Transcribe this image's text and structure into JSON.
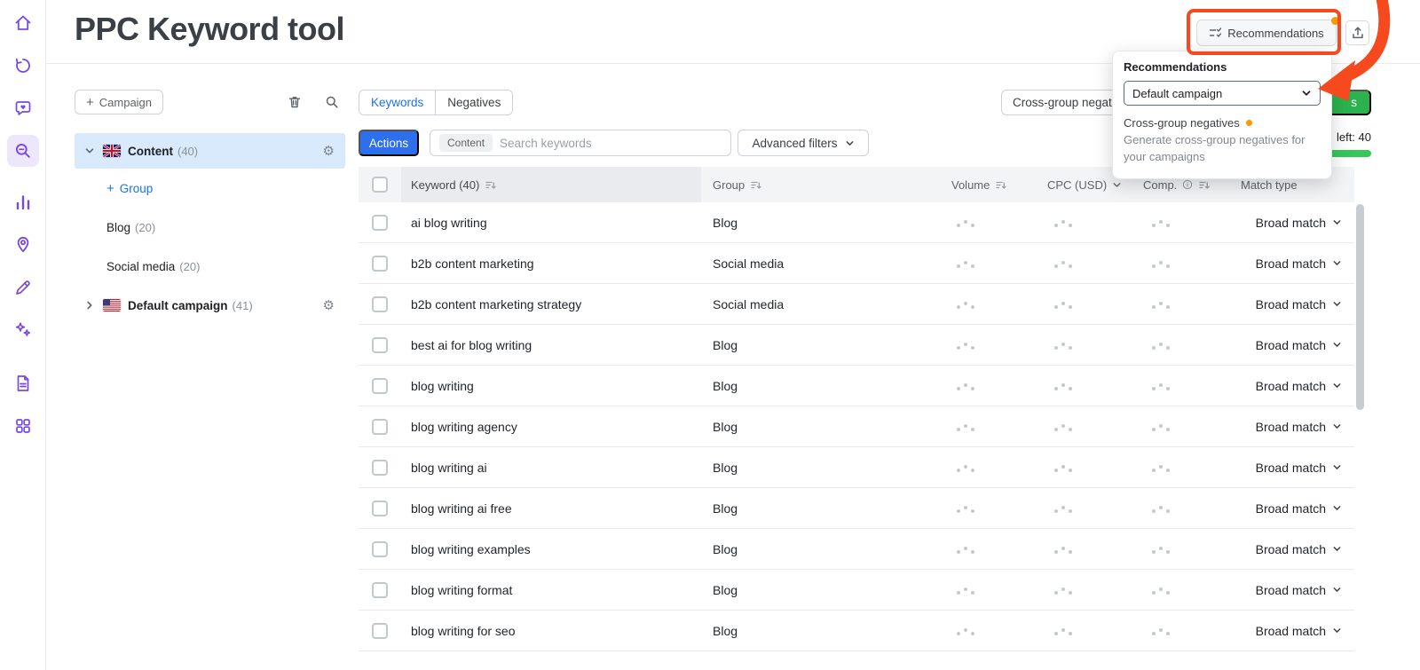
{
  "app_title": "PPC Keyword tool",
  "colors": {
    "accent_purple": "#7747e8",
    "accent_blue": "#2e6fed",
    "link_blue": "#1a73e8",
    "annotation_orange": "#f6491d",
    "notification_dot": "#ff9800",
    "green_button": "#2cb34d",
    "progress_green": "#35c759",
    "selected_tree_bg": "#d9eafd"
  },
  "sidebar": {
    "icons": [
      "home-icon",
      "sync-icon",
      "heart-chat-icon",
      "keyword-research-icon",
      "analytics-icon",
      "location-icon",
      "edit-icon",
      "ai-sparkles-icon",
      "reports-icon",
      "apps-icon"
    ],
    "active_icon": "keyword-research-icon"
  },
  "header": {
    "recommendations_button": "Recommendations"
  },
  "popover": {
    "title": "Recommendations",
    "campaign_select_value": "Default campaign",
    "item_title": "Cross-group negatives",
    "item_description": "Generate cross-group negatives for your campaigns"
  },
  "campaigns_panel": {
    "add_campaign_label": "Campaign",
    "tree": {
      "content_label": "Content",
      "content_count": "(40)",
      "add_group_label": "Group",
      "groups": [
        {
          "label": "Blog",
          "count": "(20)"
        },
        {
          "label": "Social media",
          "count": "(20)"
        }
      ],
      "default_campaign_label": "Default campaign",
      "default_campaign_count": "(41)"
    }
  },
  "toolbar": {
    "tabs": {
      "keywords": "Keywords",
      "negatives": "Negatives"
    },
    "cross_group_button": "Cross-group negat",
    "green_button_visible_text": "s",
    "quota_text": "left: 40",
    "actions_button": "Actions",
    "search_chip": "Content",
    "search_placeholder": "Search keywords",
    "advanced_filters_button": "Advanced filters"
  },
  "table": {
    "columns": {
      "keyword": "Keyword (40)",
      "group": "Group",
      "volume": "Volume",
      "cpc": "CPC (USD)",
      "comp": "Comp.",
      "match_type": "Match type"
    },
    "rows": [
      {
        "keyword": "ai blog writing",
        "group": "Blog",
        "match": "Broad match"
      },
      {
        "keyword": "b2b content marketing",
        "group": "Social media",
        "match": "Broad match"
      },
      {
        "keyword": "b2b content marketing strategy",
        "group": "Social media",
        "match": "Broad match"
      },
      {
        "keyword": "best ai for blog writing",
        "group": "Blog",
        "match": "Broad match"
      },
      {
        "keyword": "blog writing",
        "group": "Blog",
        "match": "Broad match"
      },
      {
        "keyword": "blog writing agency",
        "group": "Blog",
        "match": "Broad match"
      },
      {
        "keyword": "blog writing ai",
        "group": "Blog",
        "match": "Broad match"
      },
      {
        "keyword": "blog writing ai free",
        "group": "Blog",
        "match": "Broad match"
      },
      {
        "keyword": "blog writing examples",
        "group": "Blog",
        "match": "Broad match"
      },
      {
        "keyword": "blog writing format",
        "group": "Blog",
        "match": "Broad match"
      },
      {
        "keyword": "blog writing for seo",
        "group": "Blog",
        "match": "Broad match"
      }
    ]
  }
}
